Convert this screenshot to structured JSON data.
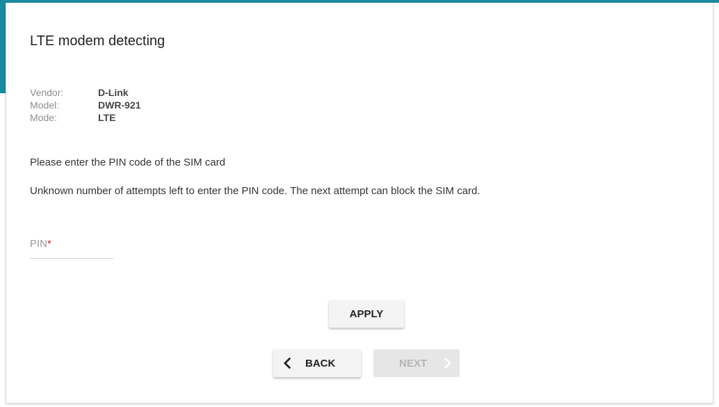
{
  "page": {
    "title": "LTE modem detecting"
  },
  "modem_info": [
    {
      "label": "Vendor:",
      "value": "D-Link"
    },
    {
      "label": "Model:",
      "value": "DWR-921"
    },
    {
      "label": "Mode:",
      "value": "LTE"
    }
  ],
  "messages": {
    "enter_pin": "Please enter the PIN code of the SIM card",
    "attempts_warning": "Unknown number of attempts left to enter the PIN code. The next attempt can block the SIM card."
  },
  "pin_field": {
    "label": "PIN",
    "required_mark": "*",
    "value": ""
  },
  "buttons": {
    "apply": "APPLY",
    "back": "BACK",
    "next": "NEXT"
  },
  "colors": {
    "accent": "#1a8a9e",
    "required": "#d9263a"
  },
  "icons": {
    "back": "chevron-left-icon",
    "next": "chevron-right-icon"
  }
}
